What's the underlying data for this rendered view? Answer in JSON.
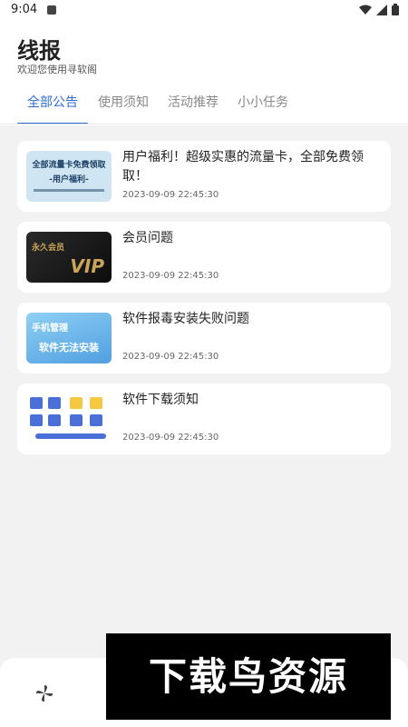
{
  "status_bar": {
    "time": "9:04"
  },
  "header": {
    "title": "线报",
    "subtitle": "欢迎您使用寻软阁"
  },
  "tabs": [
    {
      "label": "全部公告",
      "active": true
    },
    {
      "label": "使用须知",
      "active": false
    },
    {
      "label": "活动推荐",
      "active": false
    },
    {
      "label": "小小任务",
      "active": false
    }
  ],
  "posts": [
    {
      "title": "用户福利！超级实惠的流量卡，全部免费领取！",
      "date": "2023-09-09 22:45:30",
      "thumb_text": [
        "全部流量卡免费领取",
        "-用户福利-"
      ],
      "thumb_colors": {
        "bg": "#cfe6f2",
        "text": "#1d3f66"
      }
    },
    {
      "title": "会员问题",
      "date": "2023-09-09 22:45:30",
      "thumb_text": [
        "永久会员",
        "VIP"
      ],
      "thumb_colors": {
        "bg": "#1a1a1a",
        "text": "#c9a45a"
      }
    },
    {
      "title": "软件报毒安装失败问题",
      "date": "2023-09-09 22:45:30",
      "thumb_text": [
        "手机管理",
        "软件无法安装"
      ],
      "thumb_colors": {
        "bg": "#6fb8ea",
        "text": "#ffffff"
      }
    },
    {
      "title": "软件下载须知",
      "date": "2023-09-09 22:45:30",
      "thumb_text": [],
      "thumb_colors": {
        "bg": "#ffffff",
        "text": "#4a6fd8"
      }
    }
  ],
  "bottom_nav": {
    "icon": "pinwheel-icon"
  },
  "watermark": {
    "text": "下载鸟资源"
  }
}
